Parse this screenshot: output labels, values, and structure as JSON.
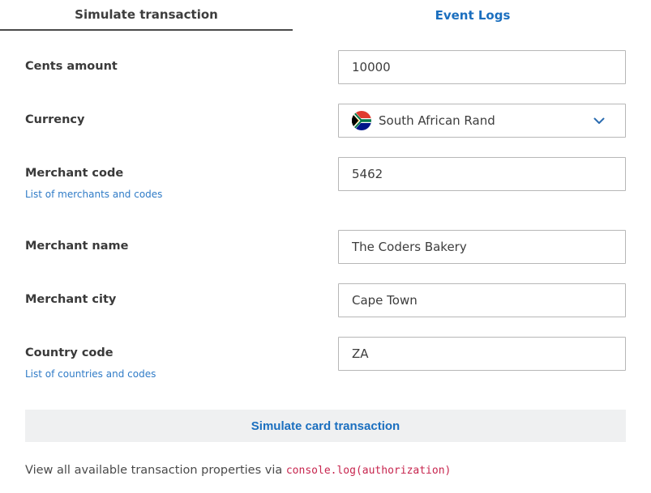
{
  "tabs": {
    "simulate": "Simulate transaction",
    "logs": "Event Logs"
  },
  "form": {
    "cents_amount": {
      "label": "Cents amount",
      "value": "10000"
    },
    "currency": {
      "label": "Currency",
      "value": "South African Rand",
      "flag": "south-africa-flag-icon"
    },
    "merchant_code": {
      "label": "Merchant code",
      "value": "5462",
      "help": "List of merchants and codes"
    },
    "merchant_name": {
      "label": "Merchant name",
      "value": "The Coders Bakery"
    },
    "merchant_city": {
      "label": "Merchant city",
      "value": "Cape Town"
    },
    "country_code": {
      "label": "Country code",
      "value": "ZA",
      "help": "List of countries and codes"
    }
  },
  "submit_label": "Simulate card transaction",
  "footer": {
    "text": "View all available transaction properties via ",
    "code": "console.log(authorization)"
  },
  "colors": {
    "accent": "#1b6fbf",
    "link": "#2f7bc7",
    "code": "#c7254e",
    "button_bg": "#eff0f1"
  }
}
